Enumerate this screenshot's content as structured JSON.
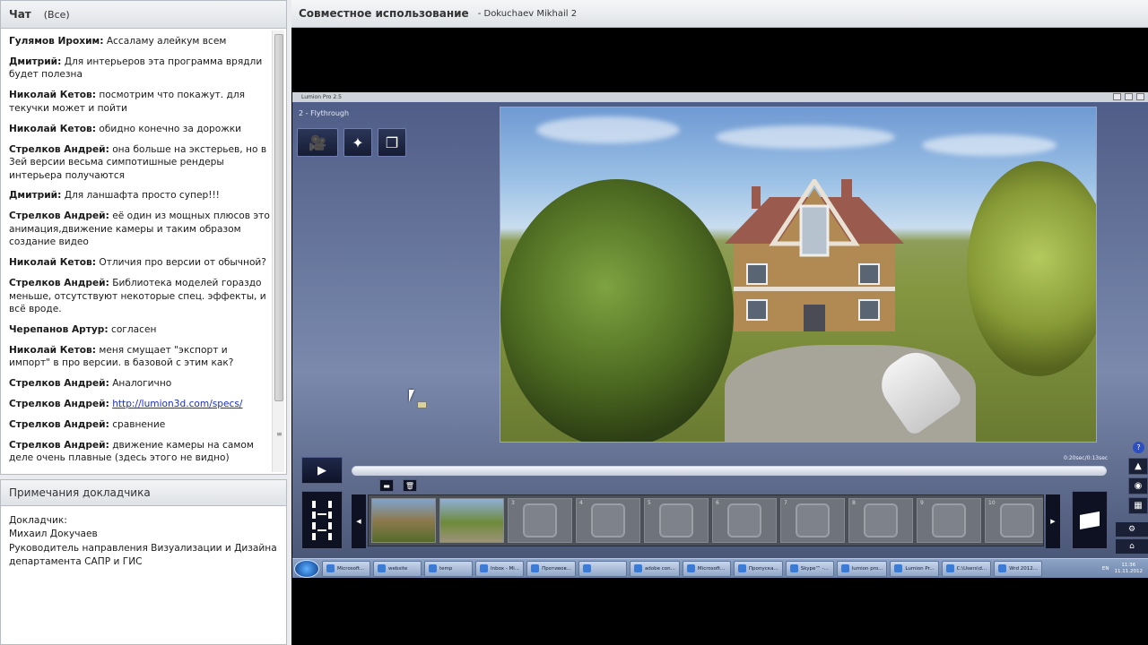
{
  "chat": {
    "title": "Чат",
    "filter": "(Все)",
    "messages": [
      {
        "author": "Гулямов Ирохим:",
        "text": "Ассаламу алейкум всем"
      },
      {
        "author": "Дмитрий:",
        "text": "Для интерьеров эта программа врядли будет полезна"
      },
      {
        "author": "Николай Кетов:",
        "text": "посмотрим что покажут. для текучки может и пойти"
      },
      {
        "author": "Николай Кетов:",
        "text": "обидно конечно за дорожки"
      },
      {
        "author": "Стрелков Андрей:",
        "text": "она больше на экстерьев, но в 3ей версии весьма симпотишные рендеры интерьера получаются"
      },
      {
        "author": "Дмитрий:",
        "text": "Для ланшафта просто супер!!!"
      },
      {
        "author": "Стрелков Андрей:",
        "text": "её один из мощных плюсов это анимация,движение камеры и таким образом создание видео"
      },
      {
        "author": "Николай Кетов:",
        "text": "Отличия про версии от обычной?"
      },
      {
        "author": "Стрелков Андрей:",
        "text": "Библиотека моделей гораздо меньше, отсутствуют некоторые спец. эффекты, и всё вроде."
      },
      {
        "author": "Черепанов Артур:",
        "text": "согласен"
      },
      {
        "author": "Николай Кетов:",
        "text": "меня смущает \"экспорт и импорт\" в про версии. в базовой с этим как?"
      },
      {
        "author": "Стрелков Андрей:",
        "text": "Аналогично"
      },
      {
        "author": "Стрелков Андрей:",
        "link": "http://lumion3d.com/specs/"
      },
      {
        "author": "Стрелков Андрей:",
        "text": "сравнение"
      },
      {
        "author": "Стрелков Андрей:",
        "text": "движение камеры на самом деле очень плавные (здесь этого не видно)"
      }
    ]
  },
  "notes": {
    "title": "Примечания докладчика",
    "lines": [
      "Докладчик:",
      "Михаил Докучаев",
      "Руководитель направления Визуализации и Дизайна департамента САПР и ГИС"
    ]
  },
  "share": {
    "title": "Совместное использование",
    "presenter": "- Dokuchaev Mikhail 2"
  },
  "lumion": {
    "window_title": "Lumion Pro 2.5",
    "mode_label": "2 - Flythrough",
    "time_label": "0:20sec/0:13sec",
    "slot_numbers": [
      "",
      "",
      "3",
      "4",
      "5",
      "6",
      "7",
      "8",
      "9",
      "10",
      "11",
      "12"
    ]
  },
  "taskbar": {
    "items": [
      "Microsoft...",
      "website",
      "temp",
      "Inbox - Mi...",
      "Противов...",
      "",
      "adobe con...",
      "Microsoft...",
      "Пропуска...",
      "Skype™ -...",
      "lumion pro...",
      "Lumion Pr...",
      "C:\\Users\\d...",
      "Wrd 2012..."
    ],
    "lang": "EN",
    "time": "11:36",
    "date": "11.11.2012"
  },
  "colors": {
    "chrome": "#dfe2e6",
    "link": "#1a2ec9",
    "share_bg": "#000000"
  }
}
